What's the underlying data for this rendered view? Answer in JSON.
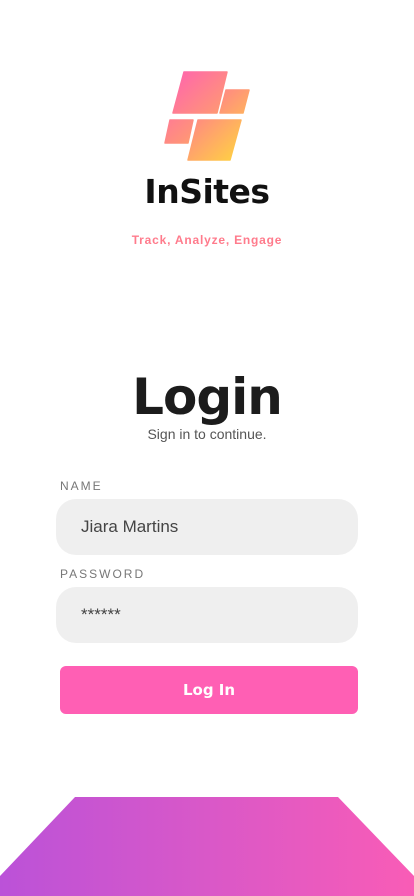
{
  "brand": {
    "name": "InSites",
    "tagline": "Track, Analyze, Engage",
    "accent": "#ff5fb4"
  },
  "login": {
    "title": "Login",
    "subtitle": "Sign in to continue.",
    "name_label": "NAME",
    "name_value": "Jiara Martins",
    "password_label": "PASSWORD",
    "password_value": "******",
    "submit_label": "Log In"
  }
}
